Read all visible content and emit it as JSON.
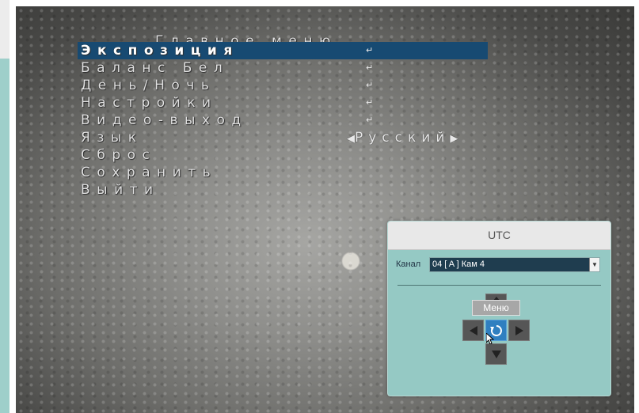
{
  "osd": {
    "title": "Главное меню",
    "items": [
      {
        "label": "Экспозиция",
        "enter": "↵",
        "selected": true
      },
      {
        "label": "Баланс Бел",
        "enter": "↵"
      },
      {
        "label": "День/Ночь",
        "enter": "↵"
      },
      {
        "label": "Настройки",
        "enter": "↵"
      },
      {
        "label": "Видео-выход",
        "enter": "↵"
      },
      {
        "label": "Язык",
        "value": "Русский"
      },
      {
        "label": "Сброс"
      },
      {
        "label": "Сохранить"
      },
      {
        "label": "Выйти"
      }
    ],
    "arrow_left": "◀",
    "arrow_right": "▶"
  },
  "utc": {
    "title": "UTC",
    "channel_label": "Канал",
    "channel_value": "04 [ A ] Кам 4",
    "menu_tooltip": "Меню"
  },
  "colors": {
    "selection": "#174a72",
    "panel_bg": "#95c9c4",
    "center_button": "#2f7fc0"
  }
}
